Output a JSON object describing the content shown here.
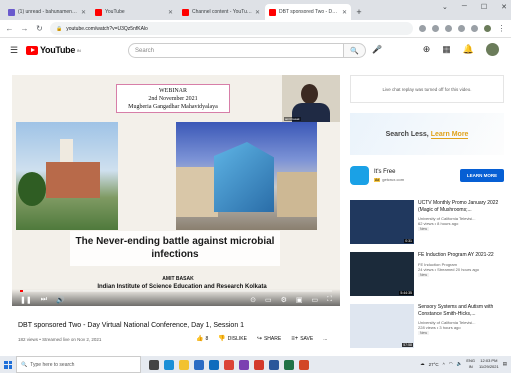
{
  "browser": {
    "tabs": [
      {
        "title": "(1) unread - bahunamenta@y...",
        "color": "#6a5acd",
        "active": false
      },
      {
        "title": "YouTube",
        "color": "#ff0000",
        "active": false
      },
      {
        "title": "Channel content - YouTube Stu...",
        "color": "#ff0000",
        "active": false
      },
      {
        "title": "DBT sponsored Two - Day V...",
        "color": "#ff0000",
        "active": true
      }
    ],
    "new_tab": "+",
    "url": "youtube.com/watch?v=U3Qz5nfKAlo"
  },
  "youtube": {
    "logo_text": "YouTube",
    "logo_sup": "IN",
    "search_placeholder": "Search"
  },
  "player": {
    "webinar_line1": "WEBINAR",
    "webinar_line2": "2nd November 2021",
    "webinar_line3": "Mugberia Gangadhar Mahavidyalaya",
    "cam_name": "amit basak",
    "slide_title": "The Never-ending battle against microbial infections",
    "author": "AMIT BASAK",
    "institute": "Indian Institute of Science Education and Research Kolkata",
    "progress_fraction": 0.01
  },
  "video": {
    "title": "DBT sponsored Two - Day Virtual National Conference, Day 1, Session 1",
    "meta": "182 views • Streamed live on Nov 2, 2021",
    "likes": "8",
    "dislike_label": "DISLIKE",
    "share_label": "SHARE",
    "save_label": "SAVE",
    "more": "..."
  },
  "sidebar": {
    "chat_notice": "Live chat replay was turned off for this video.",
    "ad_text_prefix": "Search Less, ",
    "ad_text_highlight": "Learn More",
    "promo_name": "It's Free",
    "promo_badge": "Ad",
    "promo_domain": "getcrux.com",
    "promo_button": "LEARN MORE",
    "recommendations": [
      {
        "title": "UCTV Monthly Promo January 2022 (Magic of Mushrooms;...",
        "channel": "University of California Televisi...",
        "stats": "62 views • 8 hours ago",
        "badge": "New",
        "duration": "0:31",
        "color": "#20385e"
      },
      {
        "title": "FE Induction Program AY 2021-22",
        "channel": "FE Induction Program",
        "stats": "24 views • Streamed 20 hours ago",
        "badge": "New",
        "duration": "5:44:35",
        "color": "#1b2a3a"
      },
      {
        "title": "Sensory Systems and Autism with Constance Smith-Hicks,...",
        "channel": "University of California Televisi...",
        "stats": "228 views • 3 hours ago",
        "badge": "New",
        "duration": "57:58",
        "color": "#dfe6f0"
      }
    ]
  },
  "taskbar": {
    "search_placeholder": "Type here to search",
    "temperature": "27°C",
    "lang": "ENG",
    "region": "IN",
    "time": "12:03 PM",
    "date": "11/29/2021"
  }
}
